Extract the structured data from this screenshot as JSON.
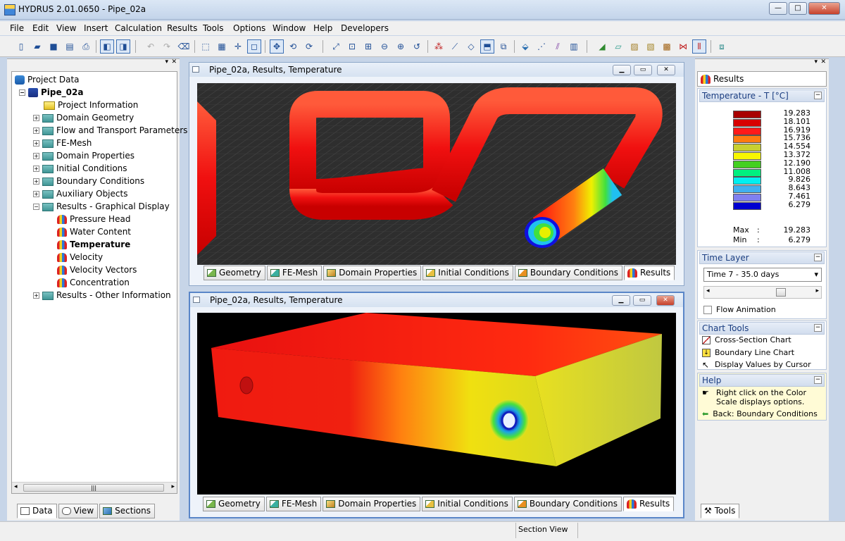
{
  "window": {
    "title": "HYDRUS 2.01.0650 - Pipe_02a",
    "min": "—",
    "max": "□",
    "close": "✕"
  },
  "menu": [
    "File",
    "Edit",
    "View",
    "Insert",
    "Calculation",
    "Results",
    "Tools",
    "Options",
    "Window",
    "Help",
    "Developers"
  ],
  "tree": {
    "root": "Project Data",
    "project": "Pipe_02a",
    "items": [
      "Project Information",
      "Domain Geometry",
      "Flow and Transport Parameters",
      "FE-Mesh",
      "Domain Properties",
      "Initial Conditions",
      "Boundary Conditions",
      "Auxiliary Objects",
      "Results - Graphical Display"
    ],
    "results": [
      "Pressure Head",
      "Water Content",
      "Temperature",
      "Velocity",
      "Velocity Vectors",
      "Concentration"
    ],
    "other": "Results - Other Information",
    "scroll_grip": "|||"
  },
  "left_tabs": [
    "Data",
    "View",
    "Sections"
  ],
  "views": [
    {
      "title": "Pipe_02a, Results, Temperature"
    },
    {
      "title": "Pipe_02a, Results, Temperature"
    }
  ],
  "view_tabs": [
    "Geometry",
    "FE-Mesh",
    "Domain Properties",
    "Initial Conditions",
    "Boundary Conditions",
    "Results"
  ],
  "right": {
    "header": "Results",
    "legend_title": "Temperature - T [°C]",
    "legend": [
      {
        "value": "19.283",
        "color": "#a80000"
      },
      {
        "value": "18.101",
        "color": "#d80000"
      },
      {
        "value": "16.919",
        "color": "#ff1a1a"
      },
      {
        "value": "15.736",
        "color": "#ff7a10"
      },
      {
        "value": "14.554",
        "color": "#c8d030"
      },
      {
        "value": "13.372",
        "color": "#f7f700"
      },
      {
        "value": "12.190",
        "color": "#44d020"
      },
      {
        "value": "11.008",
        "color": "#00f080"
      },
      {
        "value": "9.826",
        "color": "#00f0f0"
      },
      {
        "value": "8.643",
        "color": "#40b0f0"
      },
      {
        "value": "7.461",
        "color": "#8080f0"
      },
      {
        "value": "6.279",
        "color": "#0000d0"
      }
    ],
    "max_label": "Max",
    "max_value": "19.283",
    "min_label": "Min",
    "min_value": "6.279",
    "time_layer_title": "Time Layer",
    "time_layer_value": "Time 7 - 35.0 days",
    "flow_animation": "Flow Animation",
    "chart_tools_title": "Chart Tools",
    "chart_tools": [
      "Cross-Section Chart",
      "Boundary Line Chart",
      "Display Values by Cursor"
    ],
    "help_title": "Help",
    "help_text": "Right click on the Color Scale displays options.",
    "help_back": "Back: Boundary Conditions",
    "tools_tab": "Tools"
  },
  "status": {
    "section_view": "Section View"
  }
}
